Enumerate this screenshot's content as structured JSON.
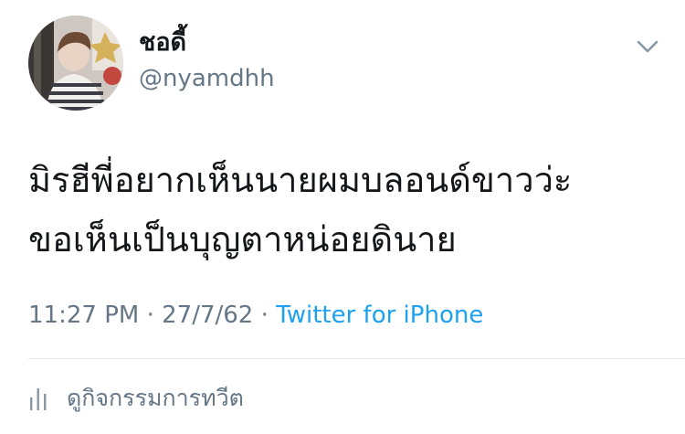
{
  "user": {
    "display_name": "ชอดี้",
    "handle": "@nyamdhh"
  },
  "tweet": {
    "lines": [
      "มิรฮีพี่อยากเห็นนายผมบลอนด์ขาวว่ะ",
      "ขอเห็นเป็นบุญตาหน่อยดินาย"
    ]
  },
  "meta": {
    "time": "11:27 PM",
    "separator1": " · ",
    "date": "27/7/62",
    "separator2": " · ",
    "source": "Twitter for iPhone"
  },
  "activity": {
    "label": "ดูกิจกรรมการทวีต"
  },
  "icons": {
    "caret": "chevron-down-icon",
    "activity": "bar-chart-icon"
  },
  "colors": {
    "text": "#14171a",
    "secondary": "#657786",
    "link": "#1da1f2",
    "divider": "#e1e8ed"
  }
}
